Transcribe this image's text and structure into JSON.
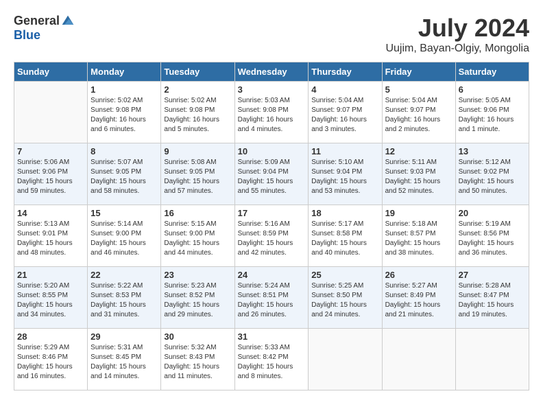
{
  "header": {
    "logo_general": "General",
    "logo_blue": "Blue",
    "month_title": "July 2024",
    "location": "Uujim, Bayan-Olgiy, Mongolia"
  },
  "weekdays": [
    "Sunday",
    "Monday",
    "Tuesday",
    "Wednesday",
    "Thursday",
    "Friday",
    "Saturday"
  ],
  "weeks": [
    [
      {
        "day": "",
        "info": ""
      },
      {
        "day": "1",
        "info": "Sunrise: 5:02 AM\nSunset: 9:08 PM\nDaylight: 16 hours\nand 6 minutes."
      },
      {
        "day": "2",
        "info": "Sunrise: 5:02 AM\nSunset: 9:08 PM\nDaylight: 16 hours\nand 5 minutes."
      },
      {
        "day": "3",
        "info": "Sunrise: 5:03 AM\nSunset: 9:08 PM\nDaylight: 16 hours\nand 4 minutes."
      },
      {
        "day": "4",
        "info": "Sunrise: 5:04 AM\nSunset: 9:07 PM\nDaylight: 16 hours\nand 3 minutes."
      },
      {
        "day": "5",
        "info": "Sunrise: 5:04 AM\nSunset: 9:07 PM\nDaylight: 16 hours\nand 2 minutes."
      },
      {
        "day": "6",
        "info": "Sunrise: 5:05 AM\nSunset: 9:06 PM\nDaylight: 16 hours\nand 1 minute."
      }
    ],
    [
      {
        "day": "7",
        "info": "Sunrise: 5:06 AM\nSunset: 9:06 PM\nDaylight: 15 hours\nand 59 minutes."
      },
      {
        "day": "8",
        "info": "Sunrise: 5:07 AM\nSunset: 9:05 PM\nDaylight: 15 hours\nand 58 minutes."
      },
      {
        "day": "9",
        "info": "Sunrise: 5:08 AM\nSunset: 9:05 PM\nDaylight: 15 hours\nand 57 minutes."
      },
      {
        "day": "10",
        "info": "Sunrise: 5:09 AM\nSunset: 9:04 PM\nDaylight: 15 hours\nand 55 minutes."
      },
      {
        "day": "11",
        "info": "Sunrise: 5:10 AM\nSunset: 9:04 PM\nDaylight: 15 hours\nand 53 minutes."
      },
      {
        "day": "12",
        "info": "Sunrise: 5:11 AM\nSunset: 9:03 PM\nDaylight: 15 hours\nand 52 minutes."
      },
      {
        "day": "13",
        "info": "Sunrise: 5:12 AM\nSunset: 9:02 PM\nDaylight: 15 hours\nand 50 minutes."
      }
    ],
    [
      {
        "day": "14",
        "info": "Sunrise: 5:13 AM\nSunset: 9:01 PM\nDaylight: 15 hours\nand 48 minutes."
      },
      {
        "day": "15",
        "info": "Sunrise: 5:14 AM\nSunset: 9:00 PM\nDaylight: 15 hours\nand 46 minutes."
      },
      {
        "day": "16",
        "info": "Sunrise: 5:15 AM\nSunset: 9:00 PM\nDaylight: 15 hours\nand 44 minutes."
      },
      {
        "day": "17",
        "info": "Sunrise: 5:16 AM\nSunset: 8:59 PM\nDaylight: 15 hours\nand 42 minutes."
      },
      {
        "day": "18",
        "info": "Sunrise: 5:17 AM\nSunset: 8:58 PM\nDaylight: 15 hours\nand 40 minutes."
      },
      {
        "day": "19",
        "info": "Sunrise: 5:18 AM\nSunset: 8:57 PM\nDaylight: 15 hours\nand 38 minutes."
      },
      {
        "day": "20",
        "info": "Sunrise: 5:19 AM\nSunset: 8:56 PM\nDaylight: 15 hours\nand 36 minutes."
      }
    ],
    [
      {
        "day": "21",
        "info": "Sunrise: 5:20 AM\nSunset: 8:55 PM\nDaylight: 15 hours\nand 34 minutes."
      },
      {
        "day": "22",
        "info": "Sunrise: 5:22 AM\nSunset: 8:53 PM\nDaylight: 15 hours\nand 31 minutes."
      },
      {
        "day": "23",
        "info": "Sunrise: 5:23 AM\nSunset: 8:52 PM\nDaylight: 15 hours\nand 29 minutes."
      },
      {
        "day": "24",
        "info": "Sunrise: 5:24 AM\nSunset: 8:51 PM\nDaylight: 15 hours\nand 26 minutes."
      },
      {
        "day": "25",
        "info": "Sunrise: 5:25 AM\nSunset: 8:50 PM\nDaylight: 15 hours\nand 24 minutes."
      },
      {
        "day": "26",
        "info": "Sunrise: 5:27 AM\nSunset: 8:49 PM\nDaylight: 15 hours\nand 21 minutes."
      },
      {
        "day": "27",
        "info": "Sunrise: 5:28 AM\nSunset: 8:47 PM\nDaylight: 15 hours\nand 19 minutes."
      }
    ],
    [
      {
        "day": "28",
        "info": "Sunrise: 5:29 AM\nSunset: 8:46 PM\nDaylight: 15 hours\nand 16 minutes."
      },
      {
        "day": "29",
        "info": "Sunrise: 5:31 AM\nSunset: 8:45 PM\nDaylight: 15 hours\nand 14 minutes."
      },
      {
        "day": "30",
        "info": "Sunrise: 5:32 AM\nSunset: 8:43 PM\nDaylight: 15 hours\nand 11 minutes."
      },
      {
        "day": "31",
        "info": "Sunrise: 5:33 AM\nSunset: 8:42 PM\nDaylight: 15 hours\nand 8 minutes."
      },
      {
        "day": "",
        "info": ""
      },
      {
        "day": "",
        "info": ""
      },
      {
        "day": "",
        "info": ""
      }
    ]
  ]
}
